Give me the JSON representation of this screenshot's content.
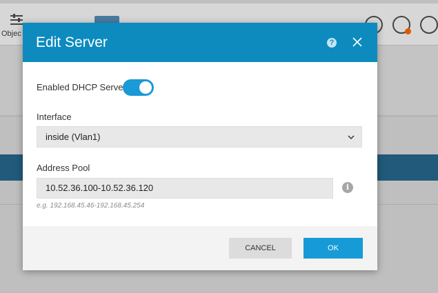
{
  "background": {
    "objects_label": "Objec"
  },
  "modal": {
    "title": "Edit Server",
    "help_icon_glyph": "?",
    "dhcp_label": "Enabled DHCP Server",
    "dhcp_enabled": true,
    "interface_label": "Interface",
    "interface_value": "inside (Vlan1)",
    "address_pool_label": "Address Pool",
    "address_pool_value": "10.52.36.100-10.52.36.120",
    "address_pool_hint": "e.g. 192.168.45.46-192.168.45.254",
    "info_icon_glyph": "i",
    "cancel_label": "CANCEL",
    "ok_label": "OK"
  },
  "colors": {
    "header": "#0d8bbf",
    "toggle_on": "#1a9ad6",
    "ok_button": "#169bd7"
  }
}
